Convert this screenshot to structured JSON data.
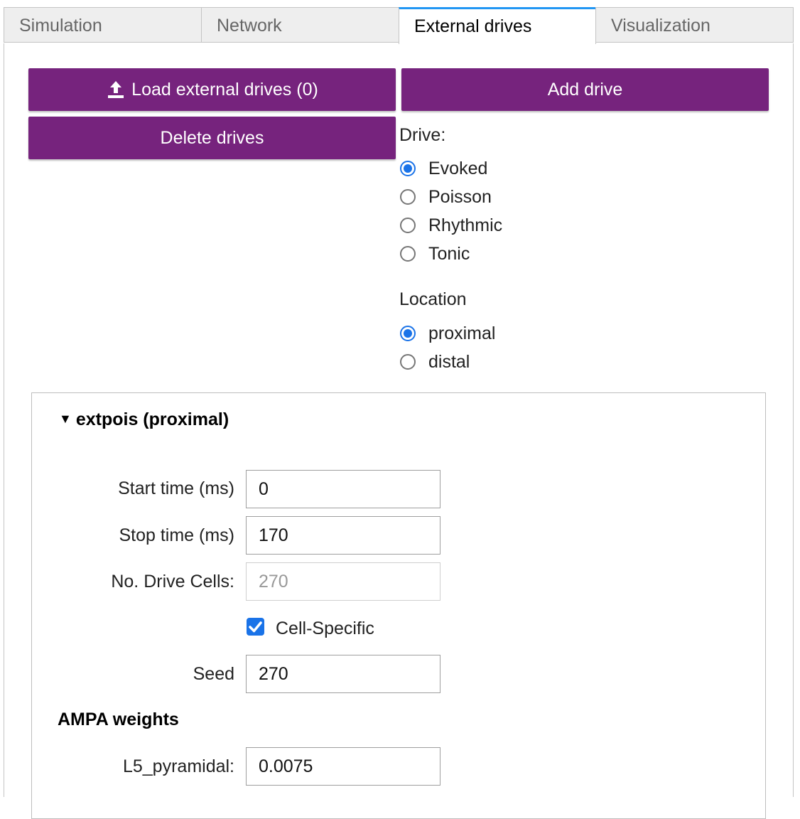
{
  "tabs": [
    {
      "label": "Simulation",
      "active": false
    },
    {
      "label": "Network",
      "active": false
    },
    {
      "label": "External drives",
      "active": true
    },
    {
      "label": "Visualization",
      "active": false
    }
  ],
  "buttons": {
    "load_drives": "Load external drives (0)",
    "add_drive": "Add drive",
    "delete_drives": "Delete drives"
  },
  "drive": {
    "label": "Drive:",
    "options": [
      "Evoked",
      "Poisson",
      "Rhythmic",
      "Tonic"
    ],
    "selected": "Evoked"
  },
  "location": {
    "label": "Location",
    "options": [
      "proximal",
      "distal"
    ],
    "selected": "proximal"
  },
  "accordion": {
    "title": "extpois (proximal)",
    "fields": {
      "start_time": {
        "label": "Start time (ms)",
        "value": "0"
      },
      "stop_time": {
        "label": "Stop time (ms)",
        "value": "170"
      },
      "n_drive_cells": {
        "label": "No. Drive Cells:",
        "value": "270",
        "disabled": true
      },
      "cell_specific": {
        "label": "Cell-Specific",
        "checked": true
      },
      "seed": {
        "label": "Seed",
        "value": "270"
      }
    },
    "ampa": {
      "heading": "AMPA weights",
      "l5_pyramidal": {
        "label": "L5_pyramidal:",
        "value": "0.0075"
      }
    }
  },
  "colors": {
    "button_bg": "#76237d",
    "accent": "#1a73e8",
    "active_tab_border": "#2196f3"
  }
}
